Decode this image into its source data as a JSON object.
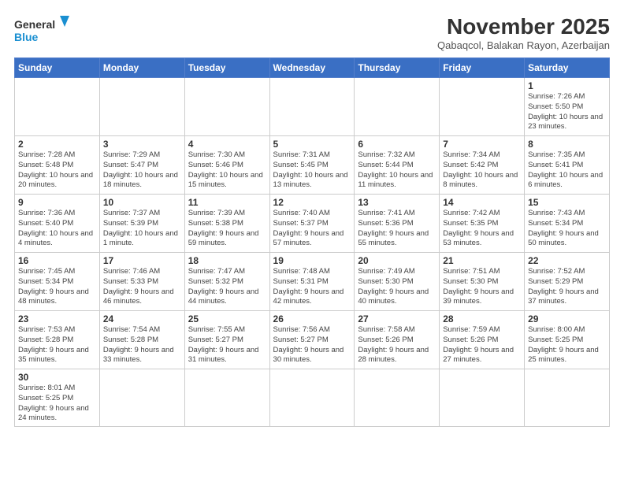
{
  "header": {
    "logo_general": "General",
    "logo_blue": "Blue",
    "month_year": "November 2025",
    "location": "Qabaqcol, Balakan Rayon, Azerbaijan"
  },
  "days_of_week": [
    "Sunday",
    "Monday",
    "Tuesday",
    "Wednesday",
    "Thursday",
    "Friday",
    "Saturday"
  ],
  "weeks": [
    [
      {
        "day": "",
        "info": ""
      },
      {
        "day": "",
        "info": ""
      },
      {
        "day": "",
        "info": ""
      },
      {
        "day": "",
        "info": ""
      },
      {
        "day": "",
        "info": ""
      },
      {
        "day": "",
        "info": ""
      },
      {
        "day": "1",
        "info": "Sunrise: 7:26 AM\nSunset: 5:50 PM\nDaylight: 10 hours\nand 23 minutes."
      }
    ],
    [
      {
        "day": "2",
        "info": "Sunrise: 7:28 AM\nSunset: 5:48 PM\nDaylight: 10 hours\nand 20 minutes."
      },
      {
        "day": "3",
        "info": "Sunrise: 7:29 AM\nSunset: 5:47 PM\nDaylight: 10 hours\nand 18 minutes."
      },
      {
        "day": "4",
        "info": "Sunrise: 7:30 AM\nSunset: 5:46 PM\nDaylight: 10 hours\nand 15 minutes."
      },
      {
        "day": "5",
        "info": "Sunrise: 7:31 AM\nSunset: 5:45 PM\nDaylight: 10 hours\nand 13 minutes."
      },
      {
        "day": "6",
        "info": "Sunrise: 7:32 AM\nSunset: 5:44 PM\nDaylight: 10 hours\nand 11 minutes."
      },
      {
        "day": "7",
        "info": "Sunrise: 7:34 AM\nSunset: 5:42 PM\nDaylight: 10 hours\nand 8 minutes."
      },
      {
        "day": "8",
        "info": "Sunrise: 7:35 AM\nSunset: 5:41 PM\nDaylight: 10 hours\nand 6 minutes."
      }
    ],
    [
      {
        "day": "9",
        "info": "Sunrise: 7:36 AM\nSunset: 5:40 PM\nDaylight: 10 hours\nand 4 minutes."
      },
      {
        "day": "10",
        "info": "Sunrise: 7:37 AM\nSunset: 5:39 PM\nDaylight: 10 hours\nand 1 minute."
      },
      {
        "day": "11",
        "info": "Sunrise: 7:39 AM\nSunset: 5:38 PM\nDaylight: 9 hours\nand 59 minutes."
      },
      {
        "day": "12",
        "info": "Sunrise: 7:40 AM\nSunset: 5:37 PM\nDaylight: 9 hours\nand 57 minutes."
      },
      {
        "day": "13",
        "info": "Sunrise: 7:41 AM\nSunset: 5:36 PM\nDaylight: 9 hours\nand 55 minutes."
      },
      {
        "day": "14",
        "info": "Sunrise: 7:42 AM\nSunset: 5:35 PM\nDaylight: 9 hours\nand 53 minutes."
      },
      {
        "day": "15",
        "info": "Sunrise: 7:43 AM\nSunset: 5:34 PM\nDaylight: 9 hours\nand 50 minutes."
      }
    ],
    [
      {
        "day": "16",
        "info": "Sunrise: 7:45 AM\nSunset: 5:34 PM\nDaylight: 9 hours\nand 48 minutes."
      },
      {
        "day": "17",
        "info": "Sunrise: 7:46 AM\nSunset: 5:33 PM\nDaylight: 9 hours\nand 46 minutes."
      },
      {
        "day": "18",
        "info": "Sunrise: 7:47 AM\nSunset: 5:32 PM\nDaylight: 9 hours\nand 44 minutes."
      },
      {
        "day": "19",
        "info": "Sunrise: 7:48 AM\nSunset: 5:31 PM\nDaylight: 9 hours\nand 42 minutes."
      },
      {
        "day": "20",
        "info": "Sunrise: 7:49 AM\nSunset: 5:30 PM\nDaylight: 9 hours\nand 40 minutes."
      },
      {
        "day": "21",
        "info": "Sunrise: 7:51 AM\nSunset: 5:30 PM\nDaylight: 9 hours\nand 39 minutes."
      },
      {
        "day": "22",
        "info": "Sunrise: 7:52 AM\nSunset: 5:29 PM\nDaylight: 9 hours\nand 37 minutes."
      }
    ],
    [
      {
        "day": "23",
        "info": "Sunrise: 7:53 AM\nSunset: 5:28 PM\nDaylight: 9 hours\nand 35 minutes."
      },
      {
        "day": "24",
        "info": "Sunrise: 7:54 AM\nSunset: 5:28 PM\nDaylight: 9 hours\nand 33 minutes."
      },
      {
        "day": "25",
        "info": "Sunrise: 7:55 AM\nSunset: 5:27 PM\nDaylight: 9 hours\nand 31 minutes."
      },
      {
        "day": "26",
        "info": "Sunrise: 7:56 AM\nSunset: 5:27 PM\nDaylight: 9 hours\nand 30 minutes."
      },
      {
        "day": "27",
        "info": "Sunrise: 7:58 AM\nSunset: 5:26 PM\nDaylight: 9 hours\nand 28 minutes."
      },
      {
        "day": "28",
        "info": "Sunrise: 7:59 AM\nSunset: 5:26 PM\nDaylight: 9 hours\nand 27 minutes."
      },
      {
        "day": "29",
        "info": "Sunrise: 8:00 AM\nSunset: 5:25 PM\nDaylight: 9 hours\nand 25 minutes."
      }
    ],
    [
      {
        "day": "30",
        "info": "Sunrise: 8:01 AM\nSunset: 5:25 PM\nDaylight: 9 hours\nand 24 minutes."
      },
      {
        "day": "",
        "info": ""
      },
      {
        "day": "",
        "info": ""
      },
      {
        "day": "",
        "info": ""
      },
      {
        "day": "",
        "info": ""
      },
      {
        "day": "",
        "info": ""
      },
      {
        "day": "",
        "info": ""
      }
    ]
  ]
}
